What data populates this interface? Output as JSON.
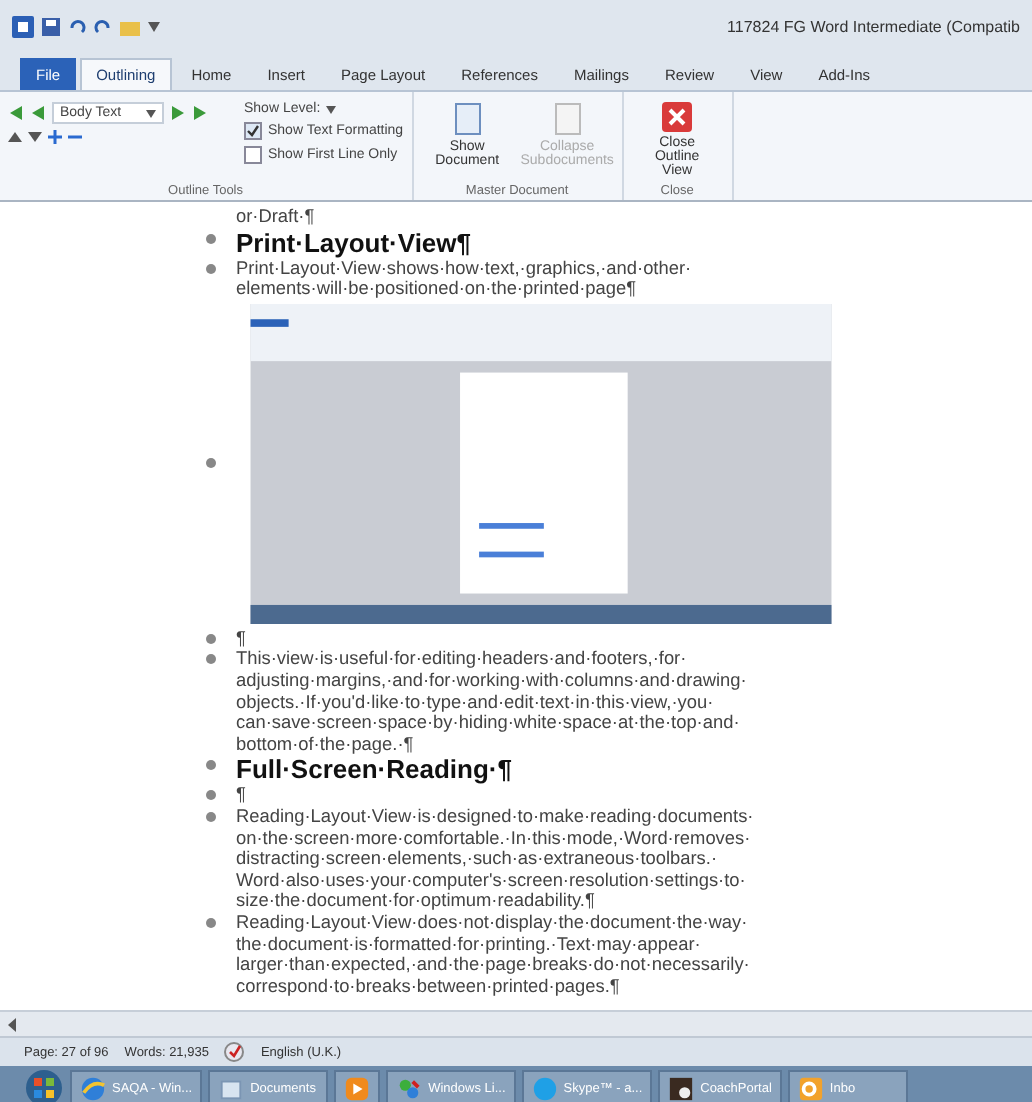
{
  "window": {
    "title": "117824 FG Word Intermediate (Compatib"
  },
  "tabs": [
    {
      "label": "File",
      "kind": "file",
      "selected": false
    },
    {
      "label": "Outlining",
      "kind": "tab",
      "selected": true
    },
    {
      "label": "Home",
      "kind": "tab",
      "selected": false
    },
    {
      "label": "Insert",
      "kind": "tab",
      "selected": false
    },
    {
      "label": "Page Layout",
      "kind": "tab",
      "selected": false
    },
    {
      "label": "References",
      "kind": "tab",
      "selected": false
    },
    {
      "label": "Mailings",
      "kind": "tab",
      "selected": false
    },
    {
      "label": "Review",
      "kind": "tab",
      "selected": false
    },
    {
      "label": "View",
      "kind": "tab",
      "selected": false
    },
    {
      "label": "Add-Ins",
      "kind": "tab",
      "selected": false
    }
  ],
  "ribbon": {
    "outline_tools": {
      "level_style": "Body Text",
      "show_level": "Show Level:",
      "show_text_formatting": {
        "label": "Show Text Formatting",
        "checked": true
      },
      "show_first_line_only": {
        "label": "Show First Line Only",
        "checked": false
      },
      "group_label": "Outline Tools"
    },
    "master_document": {
      "buttons": [
        {
          "label": "Show Document",
          "disabled": false
        },
        {
          "label": "Collapse Subdocuments",
          "disabled": true
        }
      ],
      "group_label": "Master Document"
    },
    "close": {
      "button": "Close Outline View",
      "group_label": "Close"
    }
  },
  "outline": [
    {
      "kind": "continuation",
      "lines": [
        "or·Draft·¶"
      ]
    },
    {
      "kind": "heading",
      "lines": [
        "Print·Layout·View¶"
      ]
    },
    {
      "kind": "body",
      "lines": [
        "Print·Layout·View·shows·how·text,·graphics,·and·other·",
        "elements·will·be·positioned·on·the·printed·page¶"
      ]
    },
    {
      "kind": "image"
    },
    {
      "kind": "body",
      "lines": [
        "¶"
      ]
    },
    {
      "kind": "body",
      "lines": [
        "This·view·is·useful·for·editing·headers·and·footers,·for·",
        "adjusting·margins,·and·for·working·with·columns·and·drawing·",
        "objects.·If·you'd·like·to·type·and·edit·text·in·this·view,·you·",
        "can·save·screen·space·by·hiding·white·space·at·the·top·and·",
        "bottom·of·the·page.·¶"
      ]
    },
    {
      "kind": "heading",
      "lines": [
        "Full·Screen·Reading·¶"
      ]
    },
    {
      "kind": "body",
      "lines": [
        "¶"
      ]
    },
    {
      "kind": "body",
      "lines": [
        "Reading·Layout·View·is·designed·to·make·reading·documents·",
        "on·the·screen·more·comfortable.·In·this·mode,·Word·removes·",
        "distracting·screen·elements,·such·as·extraneous·toolbars.·",
        "Word·also·uses·your·computer's·screen·resolution·settings·to·",
        "size·the·document·for·optimum·readability.¶"
      ]
    },
    {
      "kind": "body",
      "lines": [
        "Reading·Layout·View·does·not·display·the·document·the·way·",
        "the·document·is·formatted·for·printing.·Text·may·appear·",
        "larger·than·expected,·and·the·page·breaks·do·not·necessarily·",
        "correspond·to·breaks·between·printed·pages.¶"
      ]
    }
  ],
  "status_bar": {
    "page": "Page: 27 of 96",
    "words": "Words: 21,935",
    "language": "English (U.K.)"
  },
  "taskbar": [
    {
      "label": "SAQA - Win...",
      "kind": "browser"
    },
    {
      "label": "Documents",
      "kind": "folder"
    },
    {
      "kind": "media"
    },
    {
      "label": "Windows Li...",
      "kind": "messenger"
    },
    {
      "label": "Skype™ - a...",
      "kind": "skype"
    },
    {
      "label": "CoachPortal",
      "kind": "portal"
    },
    {
      "label": "Inbo",
      "kind": "mail"
    }
  ]
}
